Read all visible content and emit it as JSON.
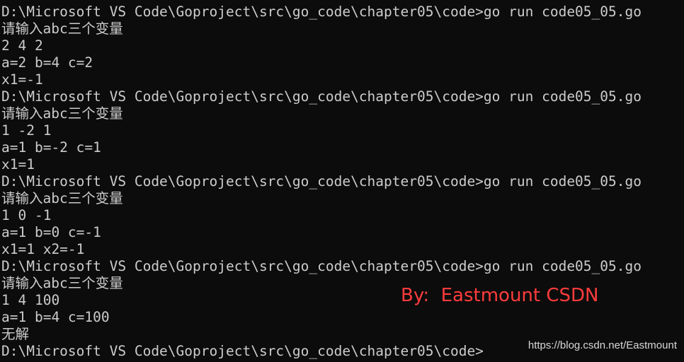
{
  "console": {
    "lines": [
      "D:\\Microsoft VS Code\\Goproject\\src\\go_code\\chapter05\\code>go run code05_05.go",
      "请输入abc三个变量",
      "2 4 2",
      "a=2 b=4 c=2",
      "x1=-1",
      "D:\\Microsoft VS Code\\Goproject\\src\\go_code\\chapter05\\code>go run code05_05.go",
      "请输入abc三个变量",
      "1 -2 1",
      "a=1 b=-2 c=1",
      "x1=1",
      "D:\\Microsoft VS Code\\Goproject\\src\\go_code\\chapter05\\code>go run code05_05.go",
      "请输入abc三个变量",
      "1 0 -1",
      "a=1 b=0 c=-1",
      "x1=1 x2=-1",
      "D:\\Microsoft VS Code\\Goproject\\src\\go_code\\chapter05\\code>go run code05_05.go",
      "请输入abc三个变量",
      "1 4 100",
      "a=1 b=4 c=100",
      "无解",
      "D:\\Microsoft VS Code\\Goproject\\src\\go_code\\chapter05\\code>"
    ]
  },
  "overlay": {
    "byline": "By:  Eastmount CSDN",
    "watermark": "https://blog.csdn.net/Eastmount"
  },
  "colors": {
    "background": "#0c0c0c",
    "text": "#cccccc",
    "byline": "#ff3c3c"
  }
}
